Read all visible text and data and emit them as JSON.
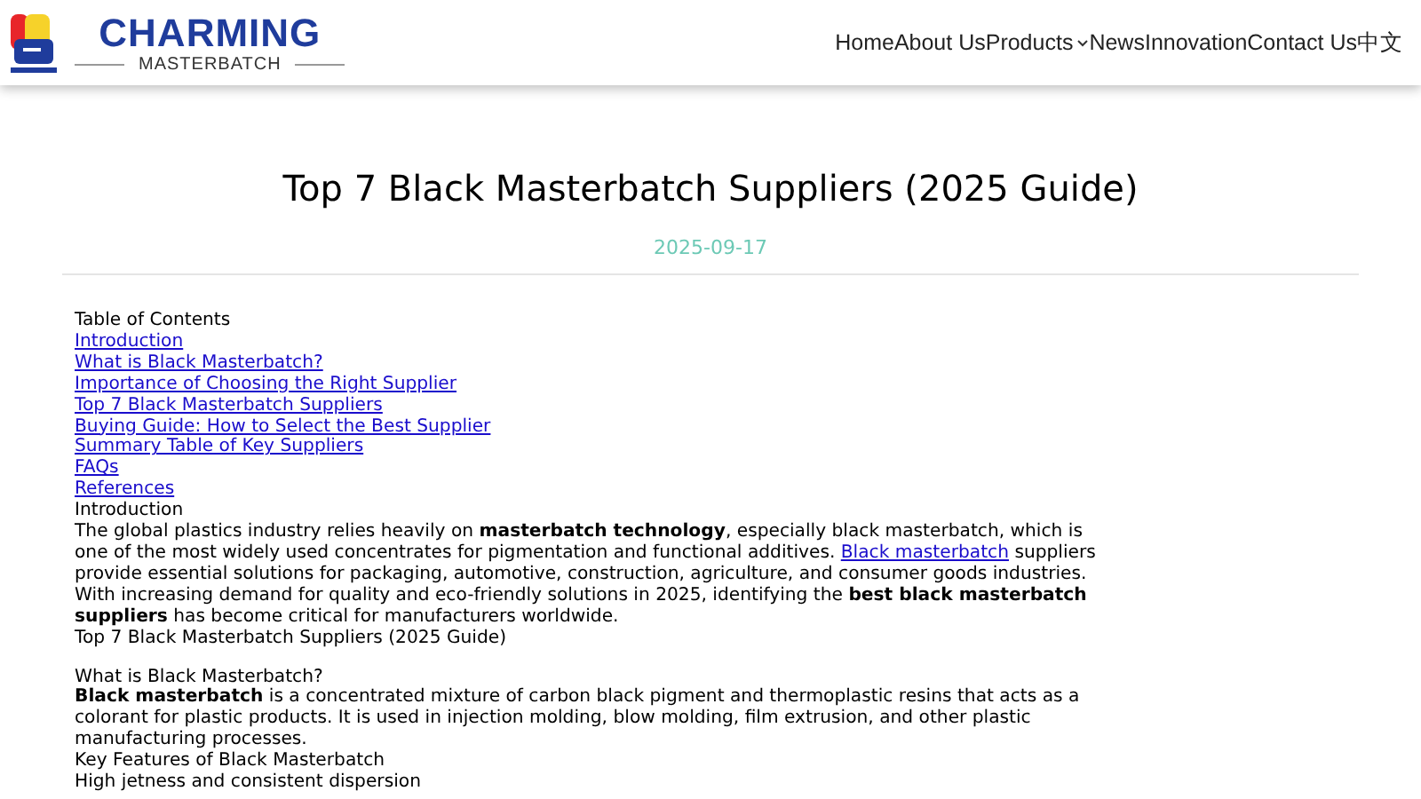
{
  "header": {
    "brand": "CHARMING",
    "tagline": "MASTERBATCH",
    "nav": [
      {
        "label": "Home",
        "dropdown": false
      },
      {
        "label": "About Us",
        "dropdown": false
      },
      {
        "label": "Products",
        "dropdown": true
      },
      {
        "label": "News",
        "dropdown": false
      },
      {
        "label": "Innovation",
        "dropdown": false
      },
      {
        "label": "Contact Us",
        "dropdown": false
      },
      {
        "label": "中文",
        "dropdown": false
      }
    ]
  },
  "article": {
    "title": "Top 7 Black Masterbatch Suppliers (2025 Guide)",
    "date": "2025-09-17",
    "toc": {
      "heading": "Table of Contents",
      "links": [
        "Introduction",
        "What is Black Masterbatch?",
        "Importance of Choosing the Right Supplier",
        "Top 7 Black Masterbatch Suppliers",
        "Buying Guide: How to Select the Best Supplier",
        "Summary Table of Key Suppliers",
        "FAQs",
        "References"
      ]
    },
    "blocks": [
      {
        "kind": "heading",
        "text": "Introduction"
      },
      {
        "kind": "paragraph",
        "before": "The global plastics industry relies heavily on **masterbatch technology**, especially black masterbatch, which is one of the most widely used concentrates for pigmentation and functional additives. ",
        "link": "Black masterbatch",
        "after": " suppliers provide essential solutions for packaging, automotive, construction, agriculture, and consumer goods industries. With increasing demand for quality and eco-friendly solutions in 2025, identifying the **best black masterbatch suppliers** has become critical for manufacturers worldwide."
      },
      {
        "kind": "heading",
        "text": "Top 7 Black Masterbatch Suppliers (2025 Guide)"
      },
      {
        "kind": "spacer"
      },
      {
        "kind": "heading",
        "text": "What is Black Masterbatch?"
      },
      {
        "kind": "paragraph",
        "before": "**Black masterbatch** is a concentrated mixture of carbon black pigment and thermoplastic resins that acts as a colorant for plastic products. It is used in injection molding, blow molding, film extrusion, and other plastic manufacturing processes."
      },
      {
        "kind": "heading",
        "text": "Key Features of Black Masterbatch"
      },
      {
        "kind": "heading",
        "text": "High jetness and consistent dispersion"
      }
    ]
  }
}
